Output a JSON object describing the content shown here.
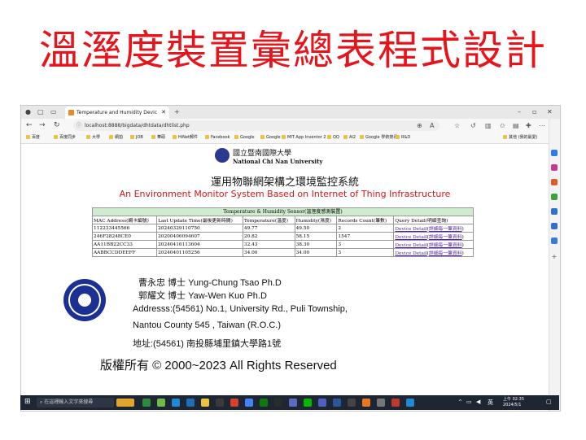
{
  "slide_title": "溫溼度裝置彙總表程式設計",
  "browser": {
    "tab_title": "Temperature and Humidity Devic",
    "url": "localhost:8888/bigdata/dhtdata/dhtlist.php",
    "bookmarks": [
      "百度",
      "百度同步",
      "大學",
      "網拍",
      "JOB",
      "華碩",
      "HiNet郵件",
      "Facebook",
      "Google",
      "Google",
      "MIT App Inventor 2",
      "QQ",
      "AI2",
      "Google 學術搜尋",
      "R&D",
      "其他 (我的最愛)"
    ]
  },
  "page": {
    "logo_cn": "國立暨南國際大學",
    "logo_en": "National Chi Nan University",
    "heading_cn": "運用物聯網架構之環境監控系統",
    "heading_en": "An Environment Monitor System Based on Internet of Thing Infrastructure"
  },
  "table": {
    "caption": "Temperature & Humidity Sensor(溫溼度感測裝置)",
    "headers": [
      "MAC Address(網卡編號)",
      "Last Update Time(最後更新時間)",
      "Temperature(溫度)",
      "Humidity(濕度)",
      "Records Count(筆數)",
      "Query Detail(明細查詢)"
    ],
    "rows": [
      {
        "mac": "112233445566",
        "time": "20240329110750",
        "temp": "49.77",
        "hum": "49.50",
        "count": "2",
        "link1": "Device Detail",
        "link2": "詳細每一筆資料"
      },
      {
        "mac": "246F28248CE0",
        "time": "20200406094607",
        "temp": "20.82",
        "hum": "58.15",
        "count": "1547",
        "link1": "Device Detail",
        "link2": "詳細每一筆資料"
      },
      {
        "mac": "AA11BB22CC33",
        "time": "20240416113604",
        "temp": "32.43",
        "hum": "38.30",
        "count": "3",
        "link1": "Device Detail",
        "link2": "詳細每一筆資料"
      },
      {
        "mac": "AABBCCDDEEFF",
        "time": "20240401105256",
        "temp": "34.00",
        "hum": "34.00",
        "count": "3",
        "link1": "Device Detail",
        "link2": "詳細每一筆資料"
      }
    ]
  },
  "footer": {
    "line1": "曹永忠 博士  Yung-Chung Tsao Ph.D",
    "line2": "郭耀文 博士 Yaw-Wen Kuo  Ph.D",
    "line3": "Addresss:(54561) No.1, University Rd., Puli Township,",
    "line4": "Nantou County 545 , Taiwan (R.O.C.)",
    "line5": "地址:(54561) 南投縣埔里鎮大學路1號",
    "copyright": "版權所有 © 2000~2023   All Rights Reserved"
  },
  "taskbar": {
    "search_placeholder": "在這裡輸入文字來搜尋",
    "lang": "英",
    "time": "上午 02:35",
    "date": "2024/5/1"
  },
  "colors": {
    "title_red": "#e8141b",
    "heading_red": "#d01818",
    "ncnu_blue": "#1c2f93",
    "caption_green": "#cfeccf"
  }
}
